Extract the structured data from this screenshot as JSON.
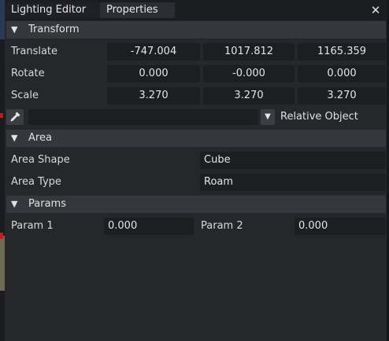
{
  "tabs": [
    "Lighting Editor",
    "Properties"
  ],
  "close_icon": "close-icon",
  "transform": {
    "title": "Transform",
    "translate": {
      "label": "Translate",
      "values": [
        "-747.004",
        "1017.812",
        "1165.359"
      ]
    },
    "rotate": {
      "label": "Rotate",
      "values": [
        "0.000",
        "-0.000",
        "0.000"
      ]
    },
    "scale": {
      "label": "Scale",
      "values": [
        "3.270",
        "3.270",
        "3.270"
      ]
    },
    "relative_object": {
      "value": "",
      "label": "Relative Object"
    }
  },
  "area": {
    "title": "Area",
    "shape": {
      "label": "Area Shape",
      "value": "Cube"
    },
    "type": {
      "label": "Area Type",
      "value": "Roam"
    }
  },
  "params": {
    "title": "Params",
    "param1": {
      "label": "Param 1",
      "value": "0.000"
    },
    "param2": {
      "label": "Param 2",
      "value": "0.000"
    }
  },
  "colors": {
    "panel": "#25272b",
    "header": "#34373c",
    "field": "#1c1e22"
  }
}
